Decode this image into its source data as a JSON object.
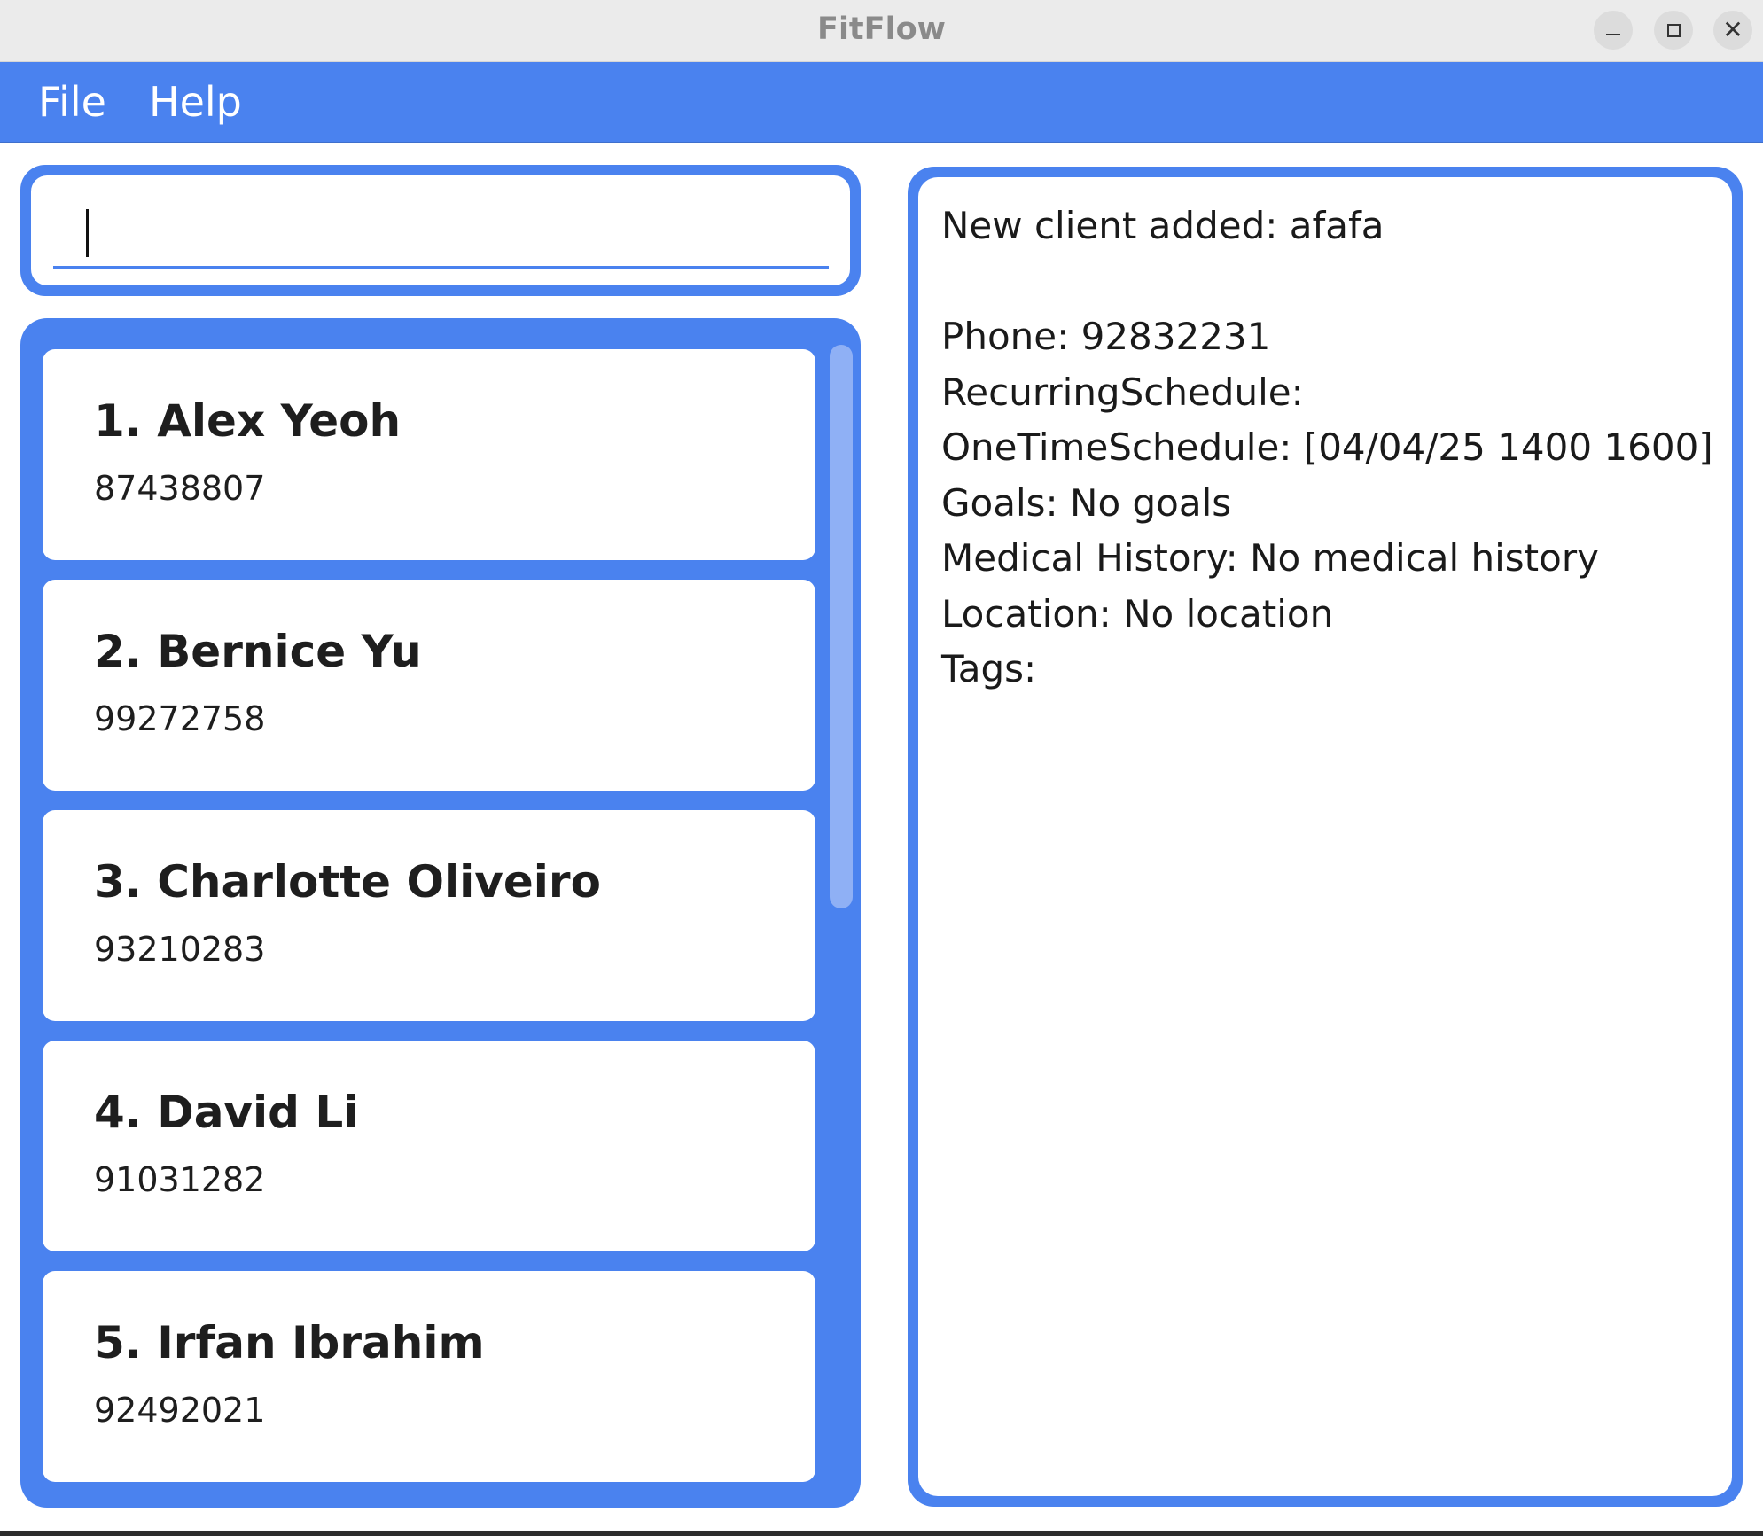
{
  "window": {
    "title": "FitFlow",
    "controls": {
      "minimize": "minimize-icon",
      "maximize": "maximize-icon",
      "close": "close-icon"
    }
  },
  "menu": {
    "file_label": "File",
    "help_label": "Help"
  },
  "command_box": {
    "value": ""
  },
  "clients": [
    {
      "name": "1. Alex Yeoh",
      "phone": "87438807"
    },
    {
      "name": "2. Bernice Yu",
      "phone": "99272758"
    },
    {
      "name": "3. Charlotte Oliveiro",
      "phone": "93210283"
    },
    {
      "name": "4. David Li",
      "phone": "91031282"
    },
    {
      "name": "5. Irfan Ibrahim",
      "phone": "92492021"
    }
  ],
  "result": {
    "text": "New client added: afafa\n\nPhone: 92832231\nRecurringSchedule: \nOneTimeSchedule: [04/04/25 1400 1600]\nGoals: No goals\nMedical History: No medical history\nLocation: No location\nTags: "
  },
  "colors": {
    "accent": "#4a82ef",
    "scrollbar_thumb": "#8fb0f5",
    "titlebar": "#ebebeb"
  }
}
